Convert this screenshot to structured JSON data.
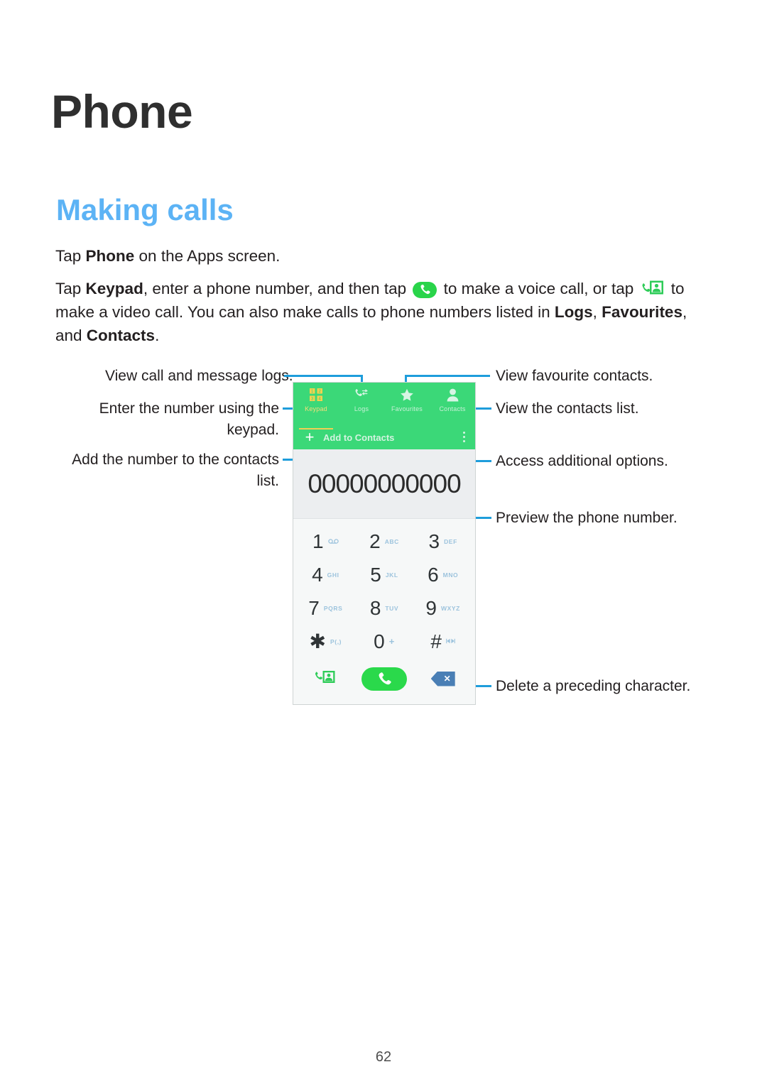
{
  "page": {
    "title": "Phone",
    "section_heading": "Making calls",
    "page_number": "62"
  },
  "paragraphs": {
    "p1_a": "Tap ",
    "p1_b": "Phone",
    "p1_c": " on the Apps screen.",
    "p2_a": "Tap ",
    "p2_b": "Keypad",
    "p2_c": ", enter a phone number, and then tap ",
    "p2_d": " to make a voice call, or tap ",
    "p2_e": " to make a video call. You can also make calls to phone numbers listed in ",
    "p2_f": "Logs",
    "p2_g": ", ",
    "p2_h": "Favourites",
    "p2_i": ", and ",
    "p2_j": "Contacts",
    "p2_k": "."
  },
  "callouts": {
    "logs": "View call and message logs.",
    "keypad_line1": "Enter the number using the",
    "keypad_line2": "keypad.",
    "add_line1": "Add the number to the contacts",
    "add_line2": "list.",
    "favourites": "View favourite contacts.",
    "contacts": "View the contacts list.",
    "more": "Access additional options.",
    "preview": "Preview the phone number.",
    "delete": "Delete a preceding character."
  },
  "phone": {
    "tabs": [
      {
        "label": "Keypad",
        "icon": "keypad-grid-icon",
        "active": true
      },
      {
        "label": "Logs",
        "icon": "call-log-icon",
        "active": false
      },
      {
        "label": "Favourites",
        "icon": "star-icon",
        "active": false
      },
      {
        "label": "Contacts",
        "icon": "person-icon",
        "active": false
      }
    ],
    "action_bar": {
      "plus": "+",
      "add_to_contacts": "Add to Contacts",
      "more_icon": "overflow-menu-icon"
    },
    "number": "00000000000",
    "keys": [
      [
        {
          "digit": "1",
          "sub": "∞",
          "sub_kind": "voicemail"
        },
        {
          "digit": "2",
          "sub": "ABC",
          "sub_kind": "letters"
        },
        {
          "digit": "3",
          "sub": "DEF",
          "sub_kind": "letters"
        }
      ],
      [
        {
          "digit": "4",
          "sub": "GHI",
          "sub_kind": "letters"
        },
        {
          "digit": "5",
          "sub": "JKL",
          "sub_kind": "letters"
        },
        {
          "digit": "6",
          "sub": "MNO",
          "sub_kind": "letters"
        }
      ],
      [
        {
          "digit": "7",
          "sub": "PQRS",
          "sub_kind": "letters"
        },
        {
          "digit": "8",
          "sub": "TUV",
          "sub_kind": "letters"
        },
        {
          "digit": "9",
          "sub": "WXYZ",
          "sub_kind": "letters"
        }
      ],
      [
        {
          "digit": "✱",
          "sub": "P(,)",
          "sub_kind": "letters"
        },
        {
          "digit": "0",
          "sub": "+",
          "sub_kind": "plus"
        },
        {
          "digit": "#",
          "sub": "◂▸",
          "sub_kind": "wait"
        }
      ]
    ],
    "bottom_actions": [
      {
        "name": "video-call-button",
        "icon": "video-call-icon"
      },
      {
        "name": "call-button",
        "icon": "phone-handset-icon"
      },
      {
        "name": "backspace-button",
        "icon": "backspace-icon",
        "glyph": "✕"
      }
    ]
  },
  "colors": {
    "heading_blue": "#5cb3f5",
    "leader_blue": "#1e9ddb",
    "app_green": "#3bd878",
    "call_green": "#2ad94b",
    "tab_active_yellow": "#f5de7a",
    "key_sub_blue": "#9cc3dd",
    "backspace_blue": "#4a7fb5"
  }
}
